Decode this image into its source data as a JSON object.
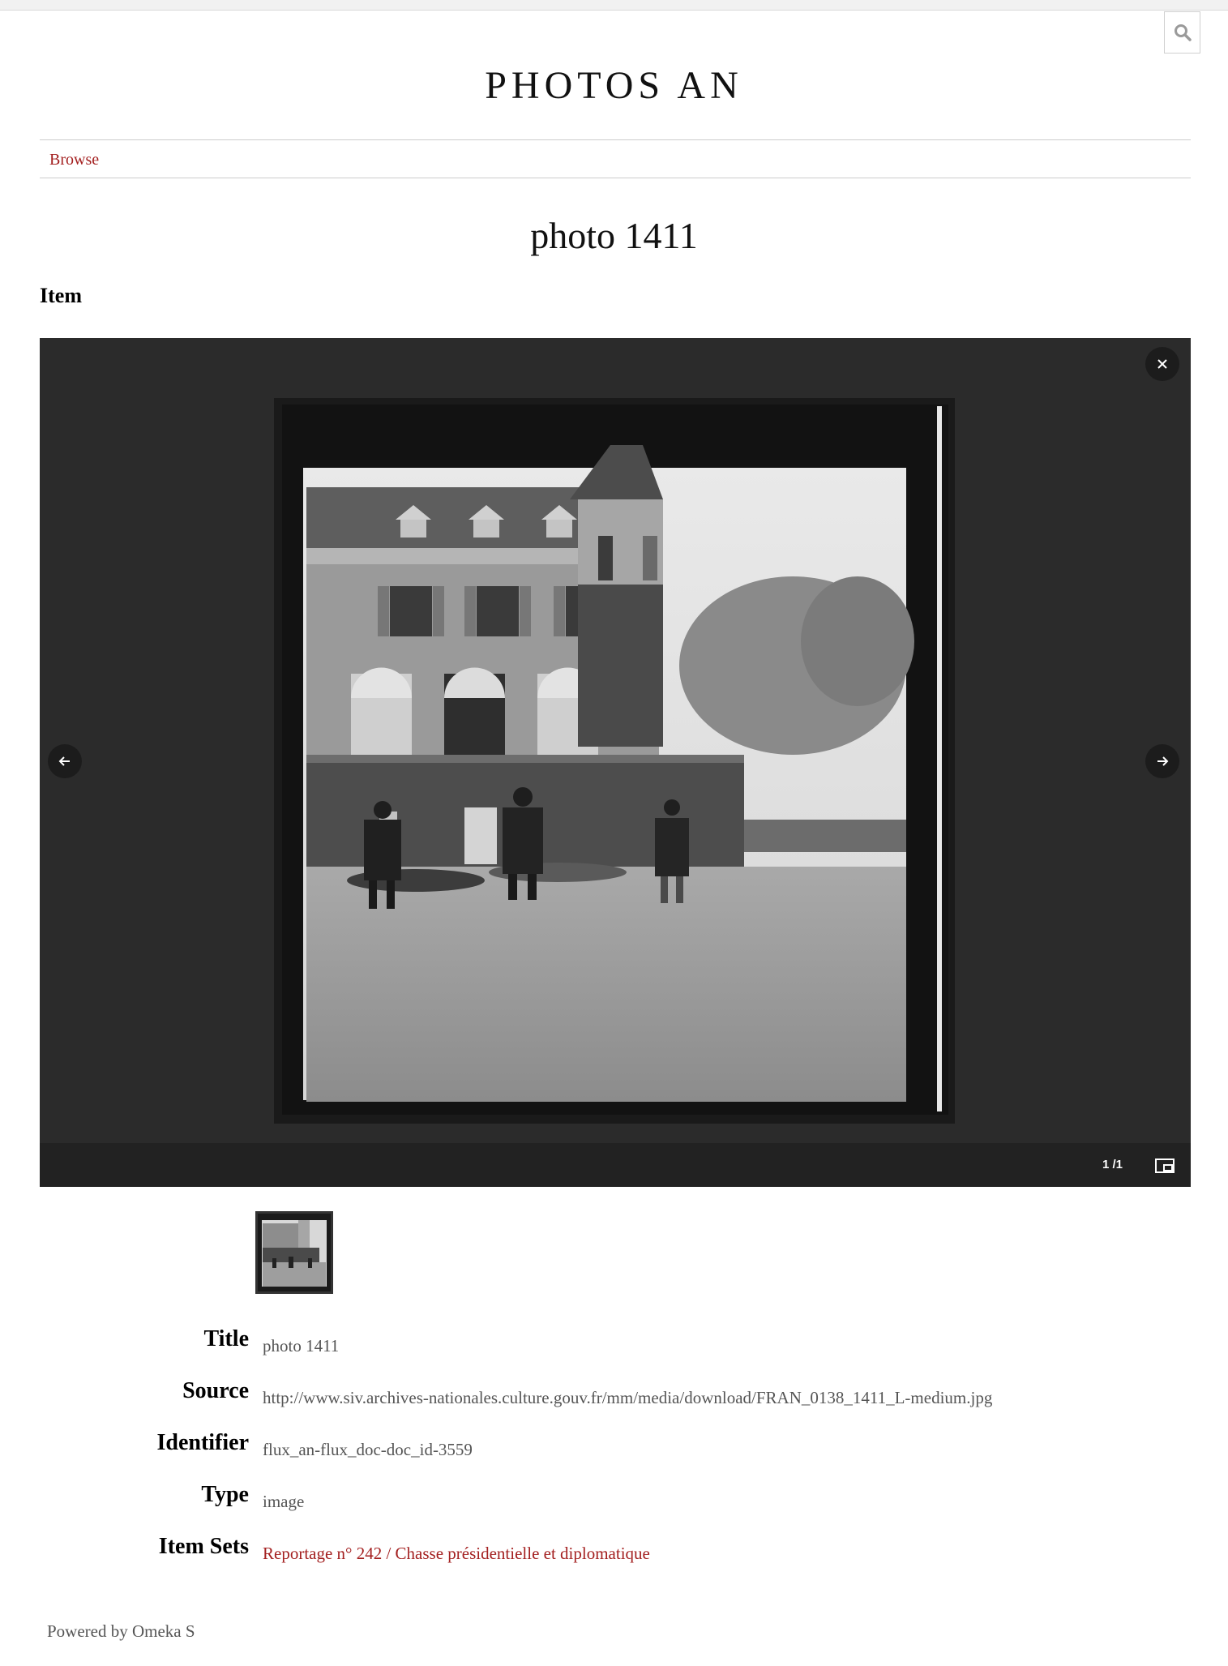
{
  "site": {
    "title": "PHOTOS AN"
  },
  "nav": {
    "browse_label": "Browse"
  },
  "page": {
    "title": "photo 1411",
    "section_label": "Item"
  },
  "viewer": {
    "counter": "1 /1",
    "icons": [
      "close-icon",
      "arrow-left-icon",
      "arrow-right-icon",
      "fullscreen-toggle-icon"
    ]
  },
  "metadata": [
    {
      "label": "Title",
      "value": "photo 1411"
    },
    {
      "label": "Source",
      "value": "http://www.siv.archives-nationales.culture.gouv.fr/mm/media/download/FRAN_0138_1411_L-medium.jpg"
    },
    {
      "label": "Identifier",
      "value": "flux_an-flux_doc-doc_id-3559"
    },
    {
      "label": "Type",
      "value": "image"
    },
    {
      "label": "Item Sets",
      "value": "Reportage n° 242 / Chasse présidentielle et diplomatique"
    }
  ],
  "footer": {
    "text": "Powered by Omeka S"
  },
  "colors": {
    "accent_link": "#a31f1f",
    "viewer_bg": "#2b2b2b",
    "text_muted": "#555555"
  }
}
